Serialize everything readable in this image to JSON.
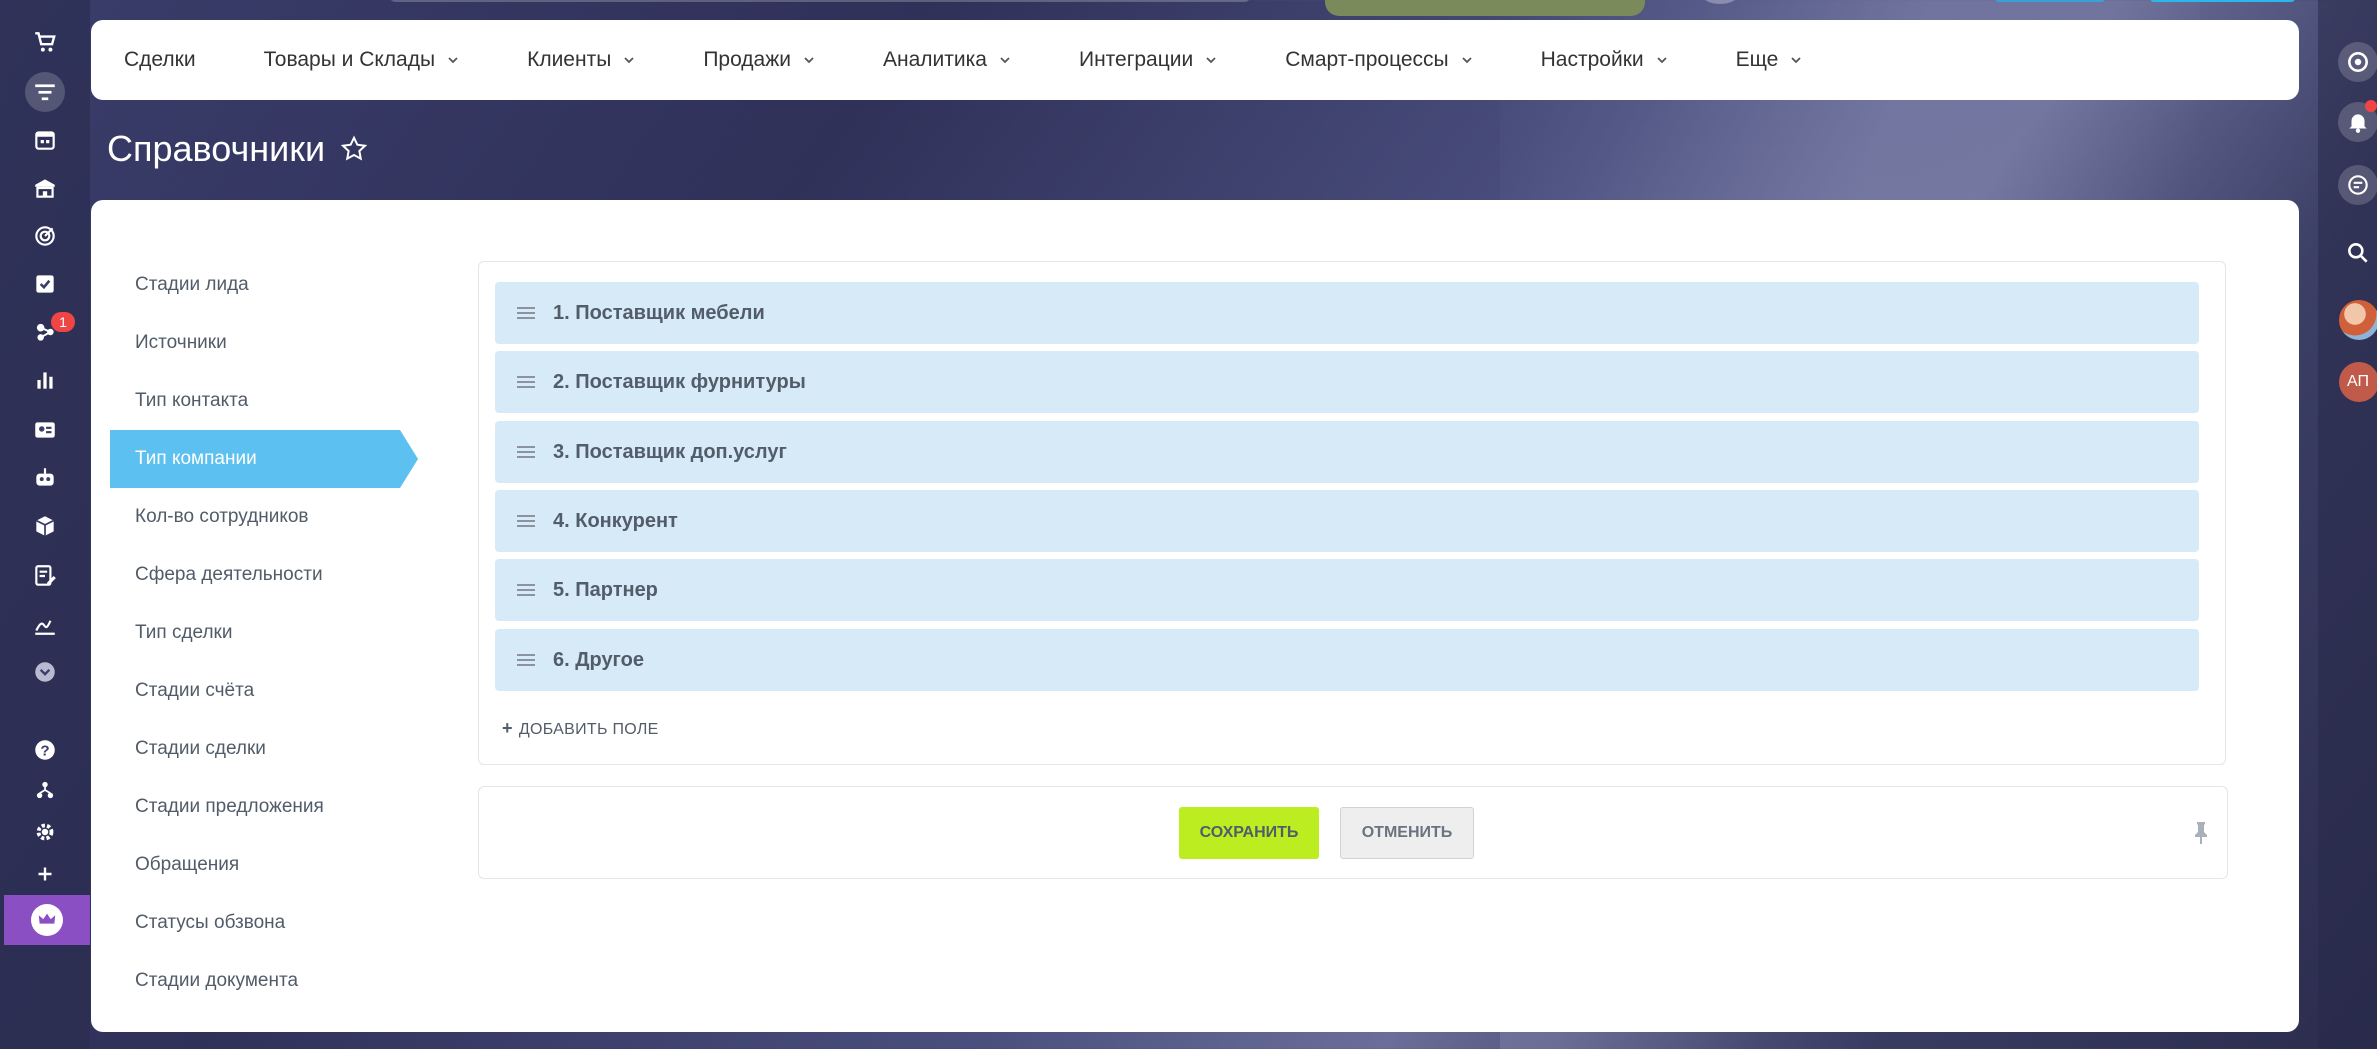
{
  "top_nav": {
    "items": [
      {
        "label": "Сделки",
        "has_dropdown": false
      },
      {
        "label": "Товары и Склады",
        "has_dropdown": true
      },
      {
        "label": "Клиенты",
        "has_dropdown": true
      },
      {
        "label": "Продажи",
        "has_dropdown": true
      },
      {
        "label": "Аналитика",
        "has_dropdown": true
      },
      {
        "label": "Интеграции",
        "has_dropdown": true
      },
      {
        "label": "Смарт-процессы",
        "has_dropdown": true
      },
      {
        "label": "Настройки",
        "has_dropdown": true
      },
      {
        "label": "Еще",
        "has_dropdown": true
      }
    ]
  },
  "page": {
    "title": "Справочники"
  },
  "left_rail": {
    "notification_badge": "1"
  },
  "right_rail": {
    "avatar_initials": "АП"
  },
  "sidebar": {
    "items": [
      {
        "label": "Стадии лида"
      },
      {
        "label": "Источники"
      },
      {
        "label": "Тип контакта"
      },
      {
        "label": "Тип компании"
      },
      {
        "label": "Кол-во сотрудников"
      },
      {
        "label": "Сфера деятельности"
      },
      {
        "label": "Тип сделки"
      },
      {
        "label": "Стадии счёта"
      },
      {
        "label": "Стадии сделки"
      },
      {
        "label": "Стадии предложения"
      },
      {
        "label": "Обращения"
      },
      {
        "label": "Статусы обзвона"
      },
      {
        "label": "Стадии документа"
      }
    ],
    "active_label": "Тип компании"
  },
  "list": {
    "items": [
      {
        "label": "1. Поставщик мебели"
      },
      {
        "label": "2. Поставщик фурнитуры"
      },
      {
        "label": "3. Поставщик доп.услуг"
      },
      {
        "label": "4. Конкурент"
      },
      {
        "label": "5. Партнер"
      },
      {
        "label": "6. Другое"
      }
    ],
    "add_field_label": "ДОБАВИТЬ ПОЛЕ"
  },
  "actions": {
    "save_label": "СОХРАНИТЬ",
    "cancel_label": "ОТМЕНИТЬ"
  },
  "colors": {
    "accent_active": "#5cc0f0",
    "row_background": "#d6ebf7",
    "save_button": "#bbed21",
    "badge": "#f04545"
  }
}
